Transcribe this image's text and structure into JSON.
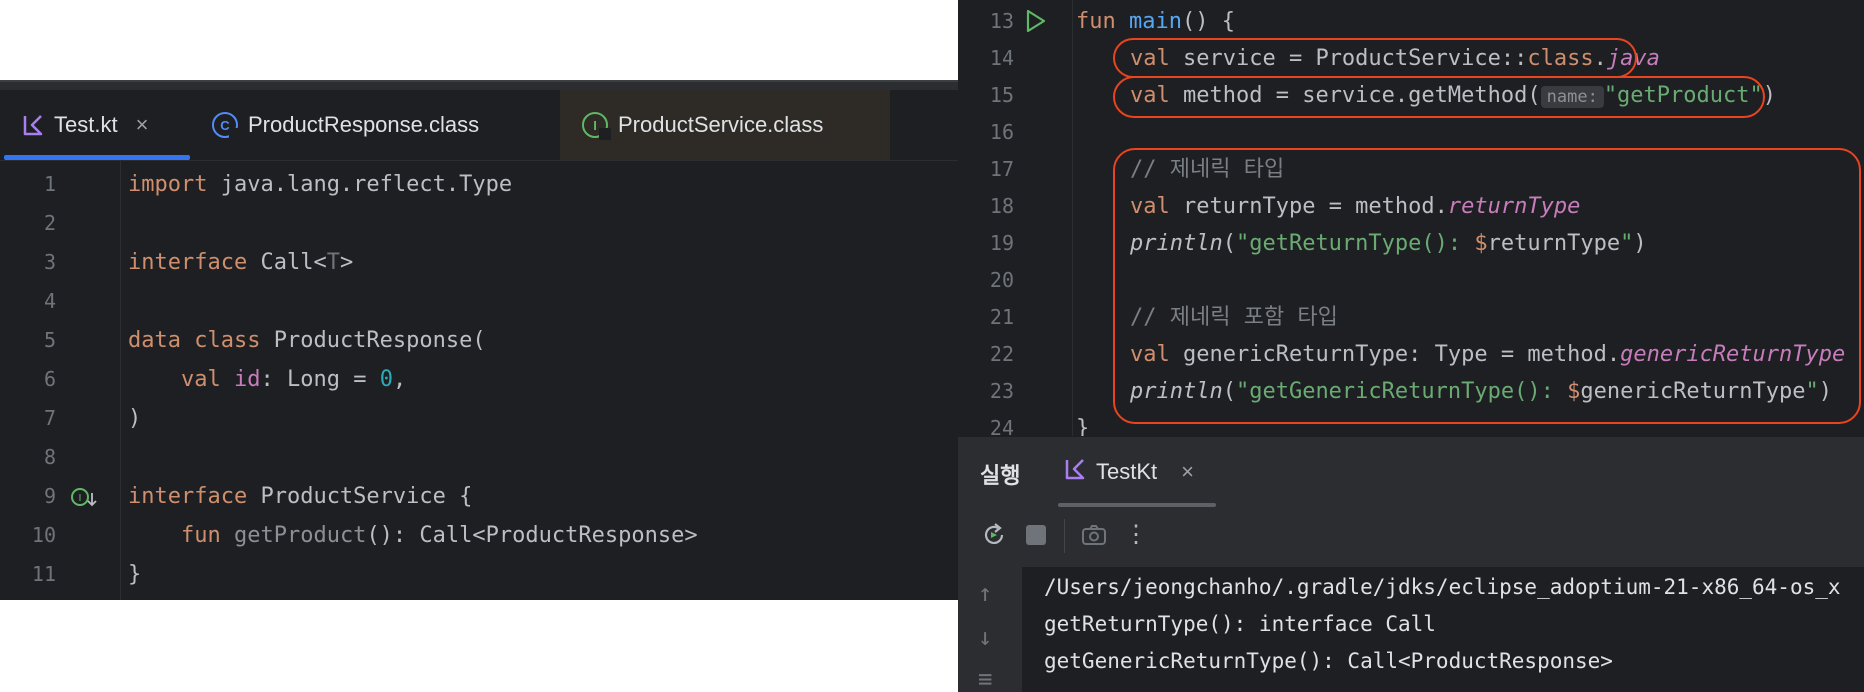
{
  "left_editor": {
    "tabs": [
      {
        "label": "Test.kt",
        "close": "×"
      },
      {
        "label": "ProductResponse.class"
      },
      {
        "label": "ProductService.class"
      }
    ],
    "lines": [
      "1",
      "2",
      "3",
      "4",
      "5",
      "6",
      "7",
      "8",
      "9",
      "10",
      "11"
    ],
    "code": {
      "l1_kw": "import",
      "l1_rest": " java.lang.reflect.Type",
      "l3_kw": "interface",
      "l3_a": " Call<",
      "l3_t": "T",
      "l3_b": ">",
      "l5_kw1": "data",
      "l5_kw2": " class",
      "l5_rest": " ProductResponse(",
      "l6_indent": "    ",
      "l6_kw": "val",
      "l6_id": " id",
      "l6_rest": ": Long = ",
      "l6_num": "0",
      "l6_end": ",",
      "l7": ")",
      "l9_kw": "interface",
      "l9_rest": " ProductService {",
      "l10_indent": "    ",
      "l10_kw": "fun",
      "l10_fn": " getProduct",
      "l10_rest": "(): Call<ProductResponse>",
      "l11": "}"
    }
  },
  "right_editor": {
    "lines": [
      "13",
      "14",
      "15",
      "16",
      "17",
      "18",
      "19",
      "20",
      "21",
      "22",
      "23",
      "24"
    ],
    "code": {
      "l13_kw": "fun",
      "l13_fn": " main",
      "l13_rest": "() {",
      "l14_kw": "val",
      "l14_a": " service = ProductService::",
      "l14_cls": "class",
      "l14_dot": ".",
      "l14_java": "java",
      "l15_kw": "val",
      "l15_a": " method = service.getMethod(",
      "l15_hint": "name:",
      "l15_str": "\"getProduct\"",
      "l15_end": ")",
      "l17_comment": "// 제네릭 타입",
      "l18_kw": "val",
      "l18_a": " returnType = method.",
      "l18_prop": "returnType",
      "l19_fn": "println",
      "l19_a": "(",
      "l19_str1": "\"getReturnType(): ",
      "l19_dollar": "$",
      "l19_var": "returnType",
      "l19_str2": "\"",
      "l19_end": ")",
      "l21_comment": "// 제네릭 포함 타입",
      "l22_kw": "val",
      "l22_a": " genericReturnType: Type = method.",
      "l22_prop": "genericReturnType",
      "l23_fn": "println",
      "l23_a": "(",
      "l23_str1": "\"getGenericReturnType(): ",
      "l23_dollar": "$",
      "l23_var": "genericReturnType",
      "l23_str2": "\"",
      "l23_end": ")",
      "l24": "}"
    }
  },
  "run_panel": {
    "title": "실행",
    "tab_label": "TestKt",
    "tab_close": "×",
    "toolbar": {
      "more": "⋮"
    },
    "output": [
      "/Users/jeongchanho/.gradle/jdks/eclipse_adoptium-21-x86_64-os_x",
      "getReturnType(): interface Call",
      "getGenericReturnType(): Call<ProductResponse>"
    ]
  },
  "colors": {
    "editor_bg": "#1e1f22",
    "keyword": "#cf8e6d",
    "string": "#6aab73",
    "property": "#c77dbb",
    "function": "#56a8f5",
    "annotation_box": "#e8441f",
    "tab_underline": "#3574f0"
  }
}
